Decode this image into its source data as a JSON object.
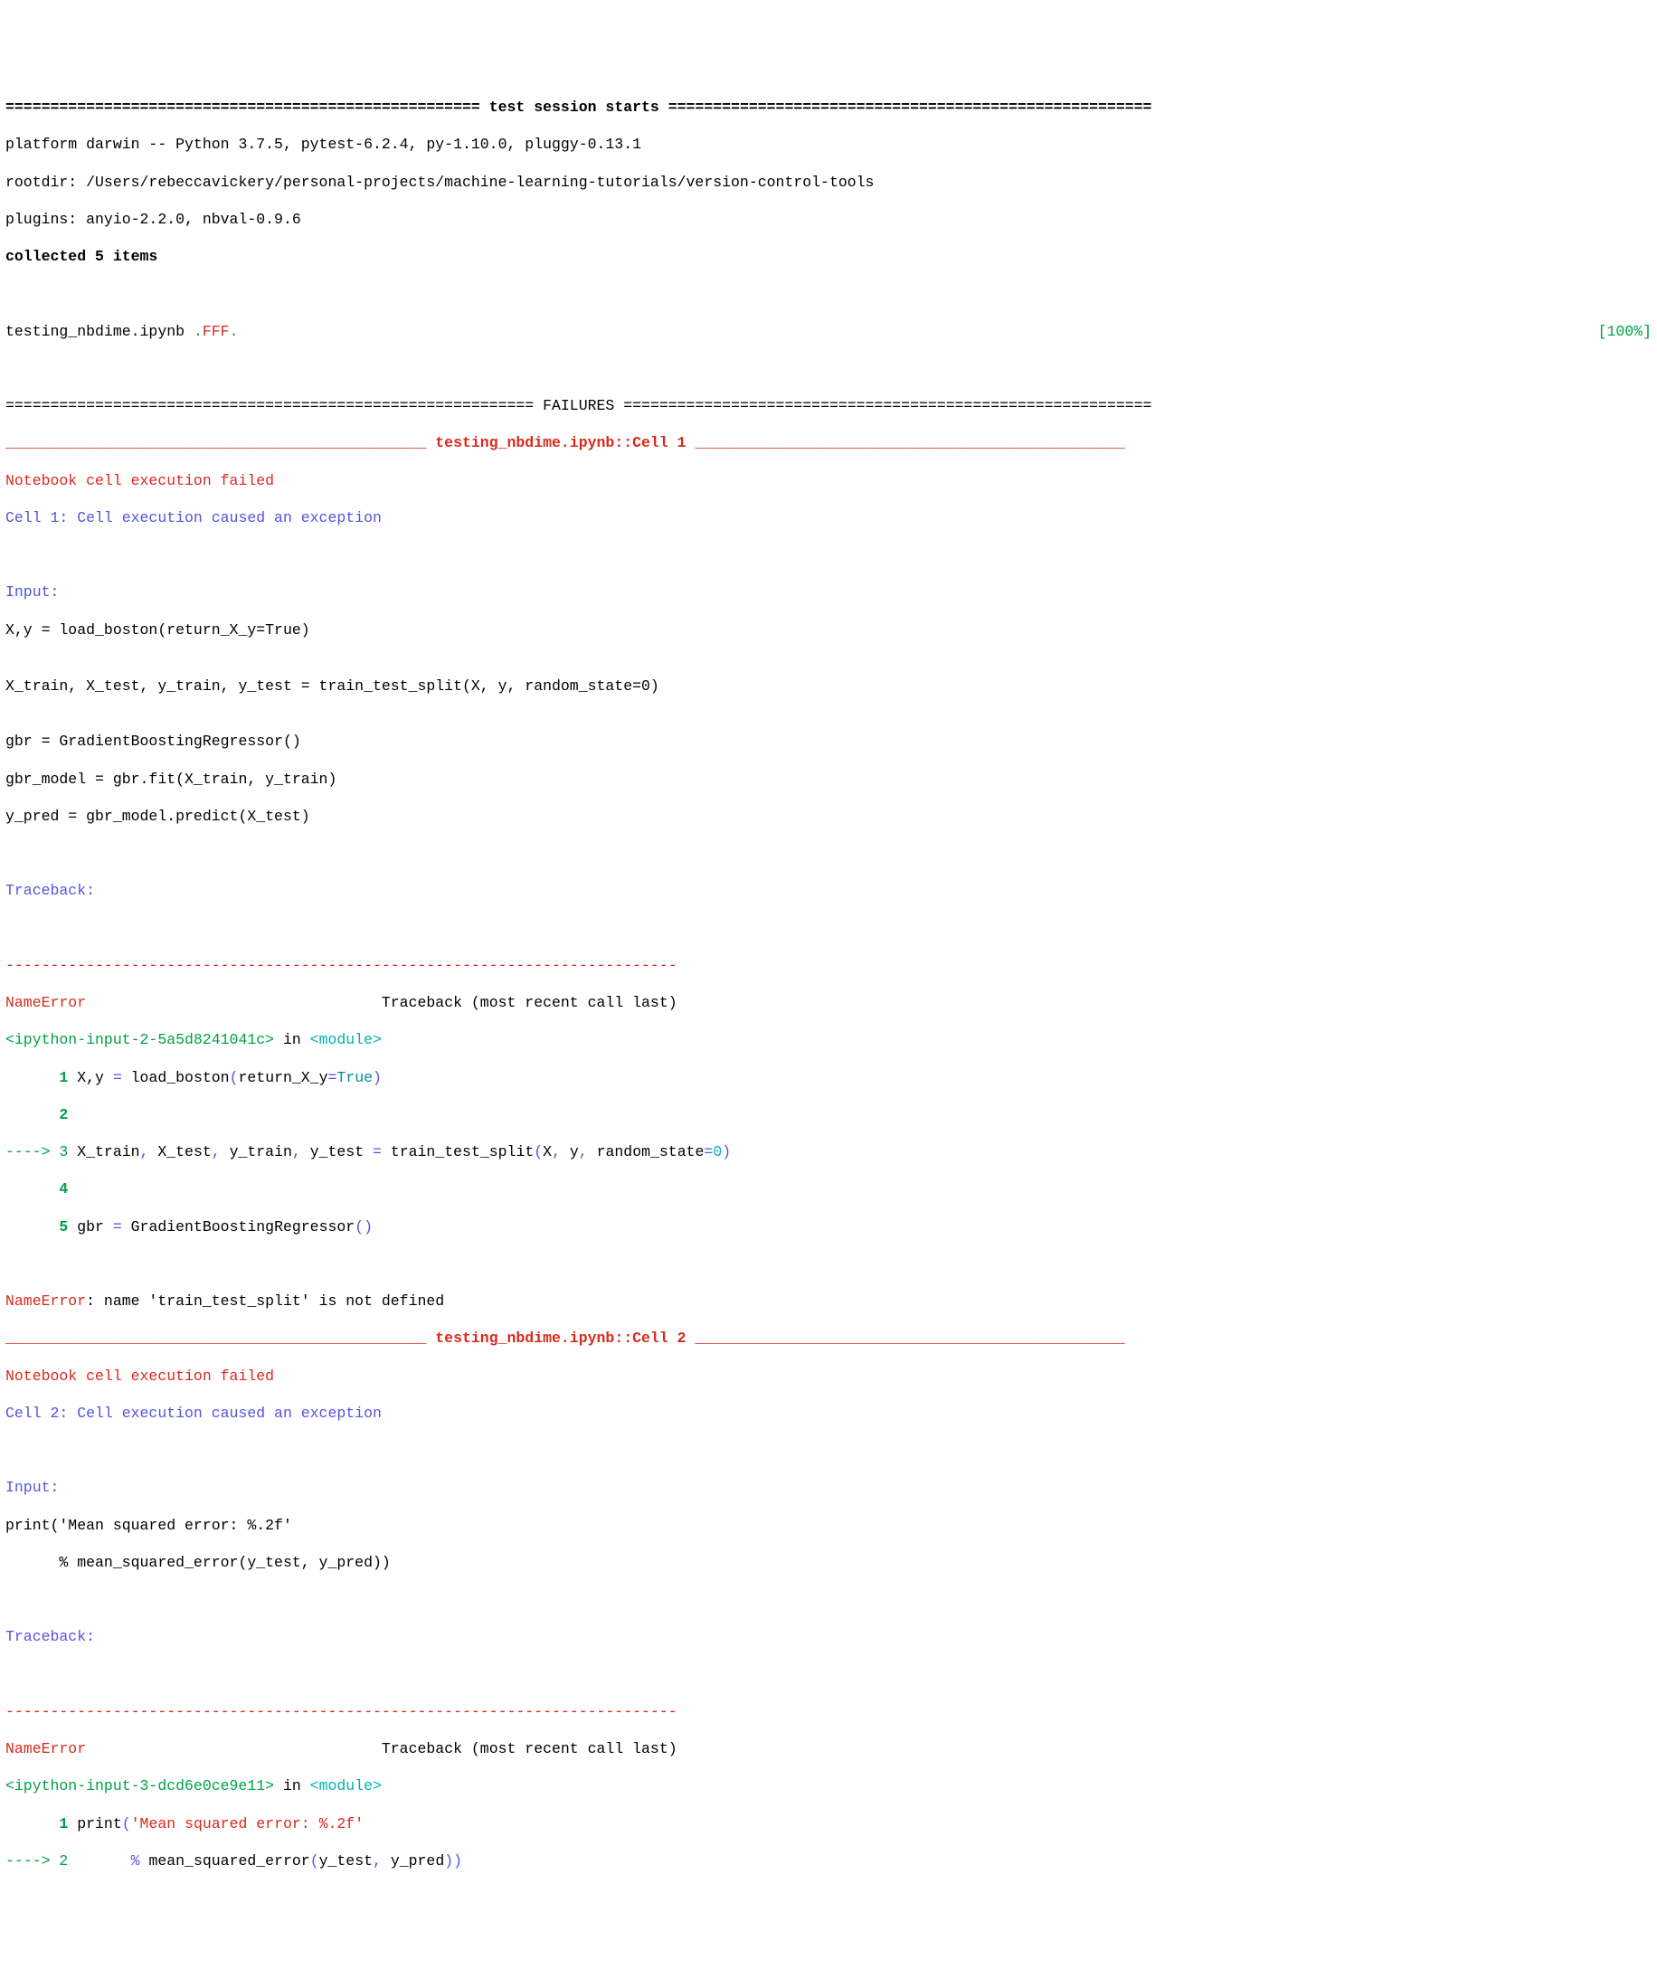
{
  "session_header": {
    "title_left": "=====================================================",
    "title_text": " test session starts ",
    "title_right": "======================================================",
    "platform": "platform darwin -- Python 3.7.5, pytest-6.2.4, py-1.10.0, pluggy-0.13.1",
    "rootdir": "rootdir: /Users/rebeccavickery/personal-projects/machine-learning-tutorials/version-control-tools",
    "plugins": "plugins: anyio-2.2.0, nbval-0.9.6",
    "collected": "collected 5 items"
  },
  "progress": {
    "file": "testing_nbdime.ipynb ",
    "dot1": ".",
    "fails": "FFF",
    "dot2": ".",
    "percent": "[100%]"
  },
  "failures_header": {
    "left": "===========================================================",
    "text": " FAILURES ",
    "right": "==========================================================="
  },
  "cell1": {
    "sep_left": "_______________________________________________ ",
    "title": "testing_nbdime.ipynb::Cell 1",
    "sep_right": " ________________________________________________",
    "exec_failed": "Notebook cell execution failed",
    "cell_msg": "Cell 1: Cell execution caused an exception",
    "input_label": "Input:",
    "input_code": [
      "X,y = load_boston(return_X_y=True)",
      "",
      "X_train, X_test, y_train, y_test = train_test_split(X, y, random_state=0)",
      "",
      "gbr = GradientBoostingRegressor()",
      "gbr_model = gbr.fit(X_train, y_train)",
      "y_pred = gbr_model.predict(X_test)"
    ],
    "traceback_label": "Traceback:",
    "tb_divider": "---------------------------------------------------------------------------",
    "tb_header_name": "NameError",
    "tb_header_rest": "                                 Traceback (most recent call last)",
    "ipython_ref": "<ipython-input-2-5a5d8241041c>",
    "in_word": " in ",
    "module_word": "<module>",
    "code_lines": {
      "l1": {
        "prefix": "      ",
        "num": "1",
        "code": " X,y ",
        "op": "=",
        "rest": " load_boston",
        "paren_open": "(",
        "arg": "return_X_y",
        "eq": "=",
        "val": "True",
        "paren_close": ")"
      },
      "l2": {
        "prefix": "      ",
        "num": "2"
      },
      "l3": {
        "arrow": "----> ",
        "num": "3",
        "code": " X_train",
        "c1": ",",
        "p2": " X_test",
        "c2": ",",
        "p3": " y_train",
        "c3": ",",
        "p4": " y_test ",
        "eq": "=",
        "fn": " train_test_split",
        "po": "(",
        "a1": "X",
        "cm1": ",",
        "a2": " y",
        "cm2": ",",
        "kw": " random_state",
        "kweq": "=",
        "kwval": "0",
        "pc": ")"
      },
      "l4": {
        "prefix": "      ",
        "num": "4"
      },
      "l5": {
        "prefix": "      ",
        "num": "5",
        "code": " gbr ",
        "eq": "=",
        "fn": " GradientBoostingRegressor",
        "po": "(",
        "pc": ")"
      }
    },
    "error_name": "NameError",
    "error_rest": ": name 'train_test_split' is not defined"
  },
  "cell2": {
    "sep_left": "_______________________________________________ ",
    "title": "testing_nbdime.ipynb::Cell 2",
    "sep_right": " ________________________________________________",
    "exec_failed": "Notebook cell execution failed",
    "cell_msg": "Cell 2: Cell execution caused an exception",
    "input_label": "Input:",
    "input_code": [
      "print('Mean squared error: %.2f'",
      "      % mean_squared_error(y_test, y_pred))"
    ],
    "traceback_label": "Traceback:",
    "tb_divider": "---------------------------------------------------------------------------",
    "tb_header_name": "NameError",
    "tb_header_rest": "                                 Traceback (most recent call last)",
    "ipython_ref": "<ipython-input-3-dcd6e0ce9e11>",
    "in_word": " in ",
    "module_word": "<module>",
    "code_lines": {
      "l1": {
        "prefix": "      ",
        "num": "1",
        "code": " print",
        "po": "(",
        "str": "'Mean squared error: %.2f'"
      },
      "l2": {
        "arrow": "----> ",
        "num": "2",
        "indent": "       ",
        "pct": "%",
        "fn": " mean_squared_error",
        "po": "(",
        "a1": "y_test",
        "c1": ",",
        "a2": " y_pred",
        "pc": ")",
        "pc2": ")"
      }
    }
  }
}
